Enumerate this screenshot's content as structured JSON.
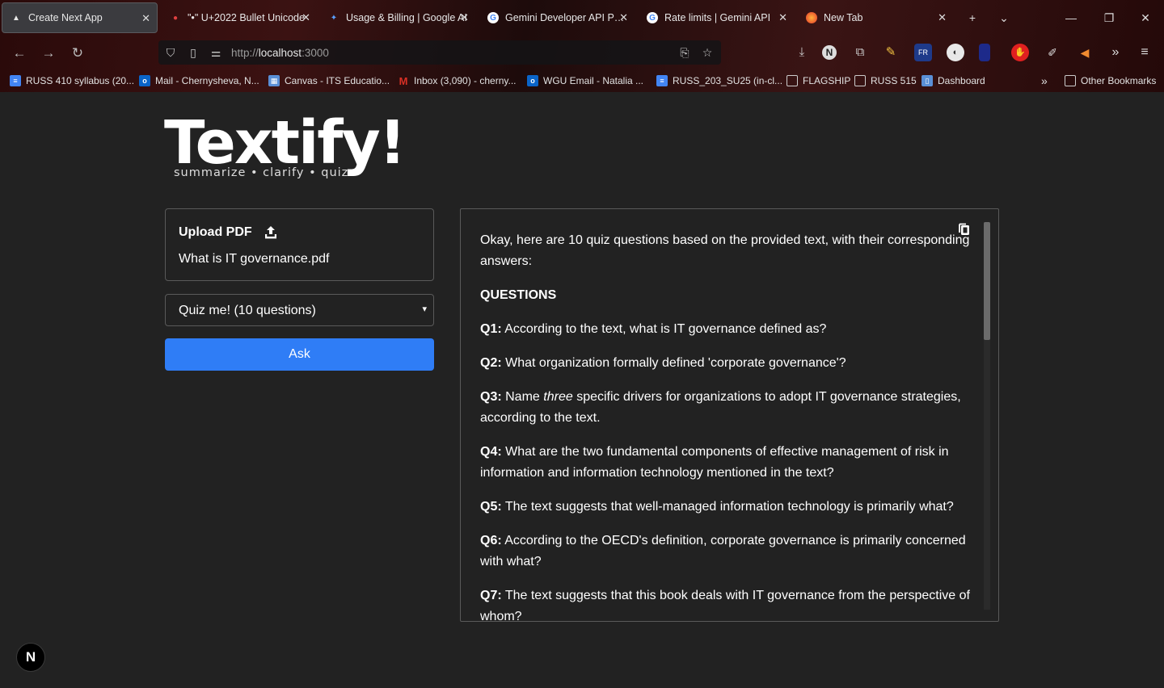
{
  "browser": {
    "tabs": [
      {
        "label": "Create Next App",
        "active": true
      },
      {
        "label": "\"•\" U+2022 Bullet Unicode",
        "active": false
      },
      {
        "label": "Usage & Billing | Google AI",
        "active": false
      },
      {
        "label": "Gemini Developer API Pricing",
        "active": false
      },
      {
        "label": "Rate limits  |  Gemini API",
        "active": false
      },
      {
        "label": "New Tab",
        "active": false
      }
    ],
    "url_prefix": "http://",
    "url_host": "localhost",
    "url_suffix": ":3000",
    "bookmarks": [
      {
        "label": "RUSS 410 syllabus (20...",
        "icon": "docs-icon",
        "color": "#4285f4"
      },
      {
        "label": "Mail - Chernysheva, N...",
        "icon": "outlook-icon",
        "color": "#0a64c8"
      },
      {
        "label": "Canvas - ITS Educatio...",
        "icon": "canvas-icon",
        "color": "#5a8fd6"
      },
      {
        "label": "Inbox (3,090) - cherny...",
        "icon": "gmail-icon",
        "color": "#d93025"
      },
      {
        "label": "WGU Email  - Natalia ...",
        "icon": "outlook-icon",
        "color": "#0a64c8"
      },
      {
        "label": "RUSS_203_SU25 (in-cl...",
        "icon": "docs-icon",
        "color": "#4285f4"
      },
      {
        "label": "FLAGSHIP",
        "icon": "folder-icon",
        "color": ""
      },
      {
        "label": "RUSS 515",
        "icon": "folder-icon",
        "color": ""
      },
      {
        "label": "Dashboard",
        "icon": "doc-icon",
        "color": "#5a8fd6"
      }
    ],
    "other_bookmarks": "Other Bookmarks"
  },
  "app": {
    "logo_title": "Textify!",
    "logo_tagline": "summarize • clarify • quiz",
    "upload_label": "Upload PDF",
    "file_name": "What is IT governance.pdf",
    "mode_selected": "Quiz me! (10 questions)",
    "ask_label": "Ask",
    "next_badge": "N",
    "output": {
      "intro": "Okay, here are 10 quiz questions based on the provided text, with their corresponding answers:",
      "heading": "QUESTIONS",
      "questions": [
        {
          "label": "Q1:",
          "text": "According to the text, what is IT governance defined as?"
        },
        {
          "label": "Q2:",
          "text": "What organization formally defined 'corporate governance'?"
        },
        {
          "label": "Q3:",
          "pre": "Name",
          "em": "three",
          "text": "specific drivers for organizations to adopt IT governance strategies, according to the text."
        },
        {
          "label": "Q4:",
          "text": "What are the two fundamental components of effective management of risk in information and information technology mentioned in the text?"
        },
        {
          "label": "Q5:",
          "text": "The text suggests that well-managed information technology is primarily what?"
        },
        {
          "label": "Q6:",
          "text": "According to the OECD's definition, corporate governance is primarily concerned with what?"
        },
        {
          "label": "Q7:",
          "text": "The text suggests that this book deals with IT governance from the perspective of whom?"
        }
      ]
    }
  },
  "colors": {
    "accent": "#2f7df6",
    "background": "#222222",
    "border": "#5a5a5a"
  }
}
